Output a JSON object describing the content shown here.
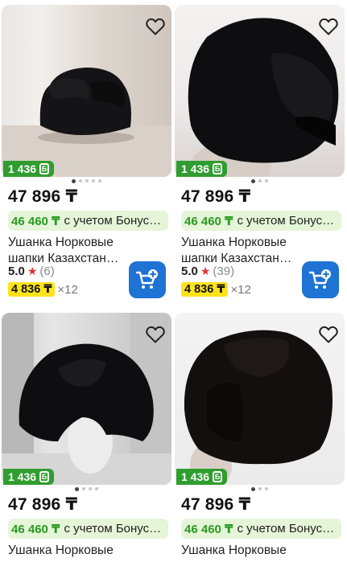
{
  "colors": {
    "bonus_badge": "#2f9d2f",
    "bonus_text": "#2a9a25",
    "bonus_bg": "#e5f5d7",
    "installment_bg": "#ffe31a",
    "cart_button": "#1e73d4",
    "star": "#e0322f"
  },
  "icons": {
    "favorite": "heart-outline-icon",
    "cart": "add-to-cart-icon",
    "star": "star-icon",
    "bonus": "bonus-coin-icon"
  },
  "products": [
    {
      "bonus_badge": "1 436",
      "price": "47 896 ₸",
      "bonus_price": "46 460 ₸",
      "bonus_text": "с учетом Бонус…",
      "title": "Ушанка Норковые шапки Казахстан…",
      "rating": "5.0",
      "reviews": "(6)",
      "installment": "4 836 ₸",
      "installment_months": "×12"
    },
    {
      "bonus_badge": "1 436",
      "price": "47 896 ₸",
      "bonus_price": "46 460 ₸",
      "bonus_text": "с учетом Бонус…",
      "title": "Ушанка Норковые шапки Казахстан…",
      "rating": "5.0",
      "reviews": "(39)",
      "installment": "4 836 ₸",
      "installment_months": "×12"
    },
    {
      "bonus_badge": "1 436",
      "price": "47 896 ₸",
      "bonus_price": "46 460 ₸",
      "bonus_text": "с учетом Бонус…",
      "title": "Ушанка Норковые"
    },
    {
      "bonus_badge": "1 436",
      "price": "47 896 ₸",
      "bonus_price": "46 460 ₸",
      "bonus_text": "с учетом Бонус…",
      "title": "Ушанка Норковые"
    }
  ]
}
